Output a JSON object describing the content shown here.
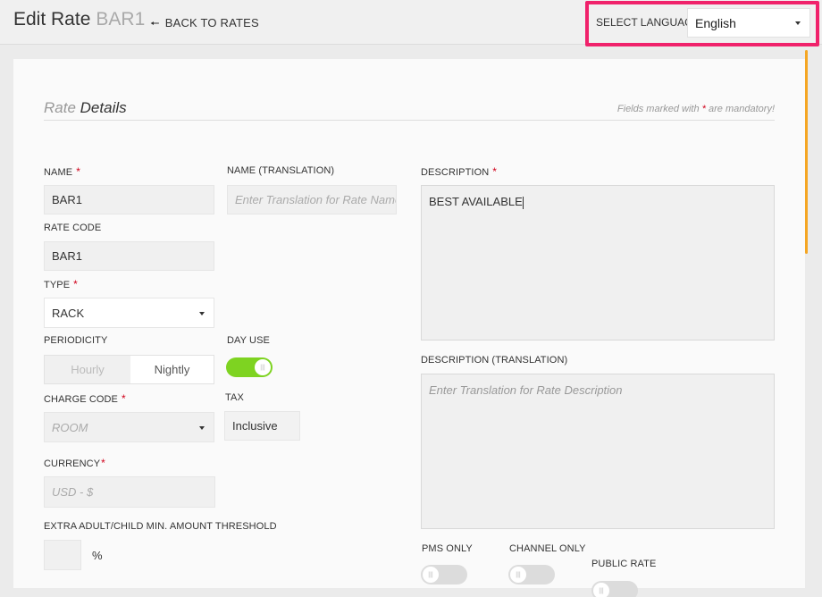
{
  "header": {
    "title": "Edit Rate",
    "rate_name": "BAR1",
    "back_link": "BACK TO RATES",
    "back_arrow": "arrow-left-icon",
    "language_label": "SELECT LANGUAGE",
    "language_value": "English"
  },
  "section": {
    "title_light": "Rate",
    "title_bold": "Details",
    "mandatory_prefix": "Fields marked with",
    "mandatory_star": "*",
    "mandatory_suffix": "are mandatory!"
  },
  "form": {
    "name": {
      "label": "NAME",
      "required": "*",
      "value": "BAR1"
    },
    "name_translation": {
      "label": "NAME (TRANSLATION)",
      "placeholder": "Enter Translation for Rate Name"
    },
    "rate_code": {
      "label": "RATE CODE",
      "value": "BAR1"
    },
    "type": {
      "label": "TYPE",
      "required": "*",
      "value": "RACK"
    },
    "periodicity": {
      "label": "PERIODICITY",
      "options": [
        "Hourly",
        "Nightly"
      ],
      "selected": "Nightly"
    },
    "day_use": {
      "label": "DAY USE",
      "on": true
    },
    "charge_code": {
      "label": "CHARGE CODE",
      "required": "*",
      "placeholder": "ROOM"
    },
    "tax": {
      "label": "TAX",
      "value": "Inclusive"
    },
    "currency": {
      "label": "CURRENCY",
      "required": "*",
      "placeholder": "USD - $"
    },
    "threshold": {
      "label": "EXTRA ADULT/CHILD MIN. AMOUNT THRESHOLD",
      "unit": "%"
    },
    "description": {
      "label": "DESCRIPTION",
      "required": "*",
      "value": "BEST AVAILABLE"
    },
    "description_translation": {
      "label": "DESCRIPTION (TRANSLATION)",
      "placeholder": "Enter Translation for Rate Description"
    },
    "pms_only": {
      "label": "PMS ONLY",
      "on": false
    },
    "channel_only": {
      "label": "CHANNEL ONLY",
      "on": false
    },
    "public_rate": {
      "label": "PUBLIC RATE",
      "on": false
    }
  },
  "colors": {
    "accent_border": "#f0226b",
    "toggle_on": "#7ed321",
    "scroll_thumb": "#f5a623",
    "required": "#d0021b"
  }
}
